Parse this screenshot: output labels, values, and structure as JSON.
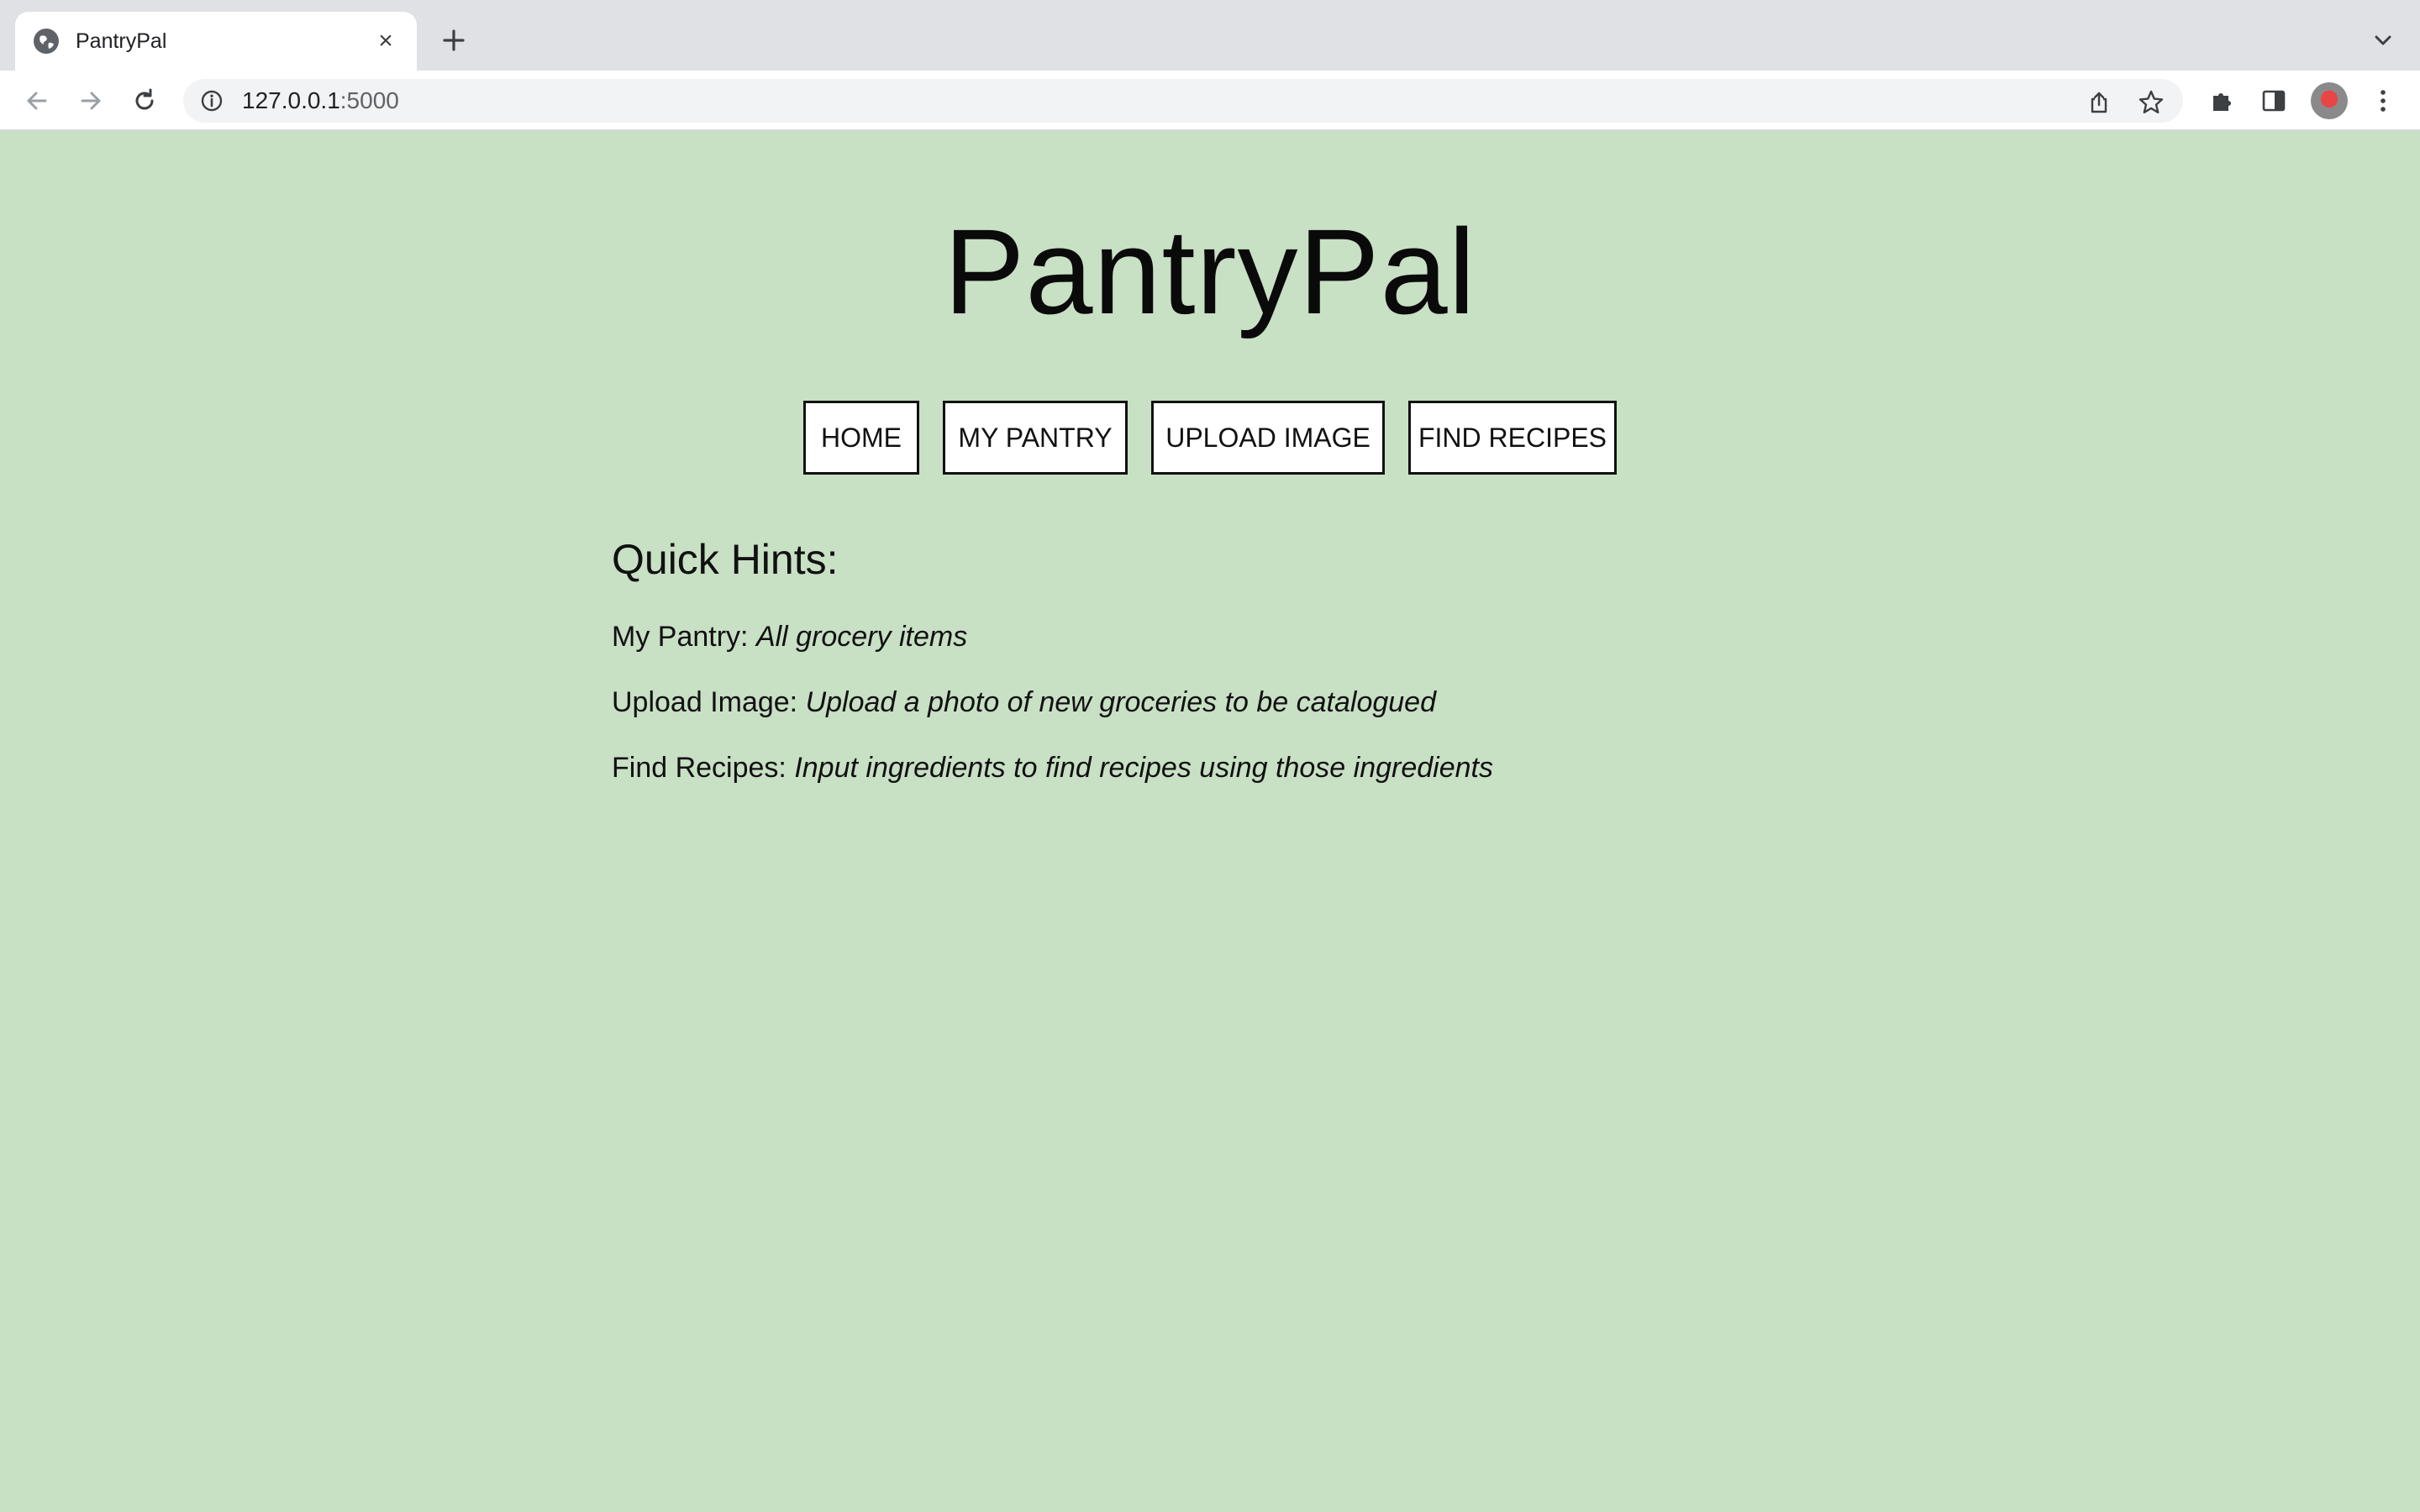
{
  "browser": {
    "tab": {
      "title": "PantryPal",
      "favicon": "globe-icon",
      "close": "×"
    },
    "address": {
      "host": "127.0.0.1",
      "port": ":5000"
    },
    "colors": {
      "tabstrip": "#dfe1e5",
      "toolbar": "#ffffff",
      "omnibox": "#f1f3f4"
    }
  },
  "page": {
    "background": "#c8e0c4",
    "title": "PantryPal",
    "nav": [
      {
        "label": "HOME"
      },
      {
        "label": "MY PANTRY"
      },
      {
        "label": "UPLOAD IMAGE"
      },
      {
        "label": "FIND RECIPES"
      }
    ],
    "hints": {
      "heading": "Quick Hints:",
      "items": [
        {
          "label": "My Pantry:",
          "description": "All grocery items"
        },
        {
          "label": "Upload Image:",
          "description": "Upload a photo of new groceries to be catalogued"
        },
        {
          "label": "Find Recipes:",
          "description": "Input ingredients to find recipes using those ingredients"
        }
      ]
    }
  }
}
